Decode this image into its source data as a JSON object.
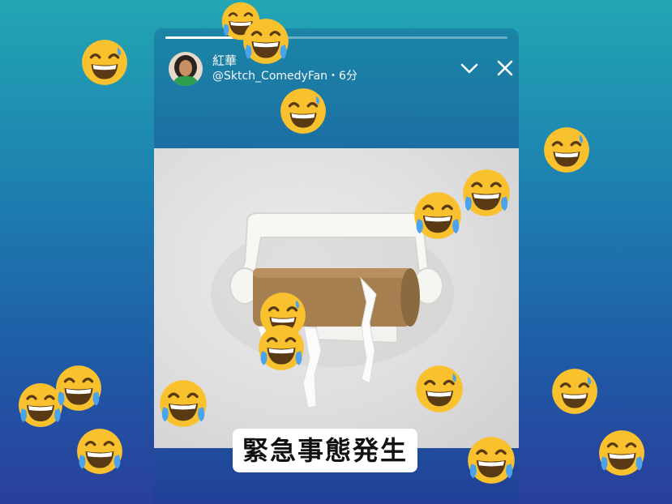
{
  "story": {
    "progress": 0.2,
    "user_name": "紅華",
    "handle_line": "@Sktch_ComedyFan・6分",
    "caption": "緊急事態発生"
  },
  "icons": {
    "collapse": "chevron-down-icon",
    "close": "close-icon",
    "reaction": "face-with-tears-of-joy-icon",
    "reaction_alt": "grinning-face-with-sweat-icon"
  },
  "colors": {
    "background_top": "#22a6b3",
    "background_bottom": "#2a3f9b",
    "emoji_yellow": "#f9c12e",
    "tear_blue": "#4aa3ec",
    "caption_bg": "#ffffff"
  }
}
